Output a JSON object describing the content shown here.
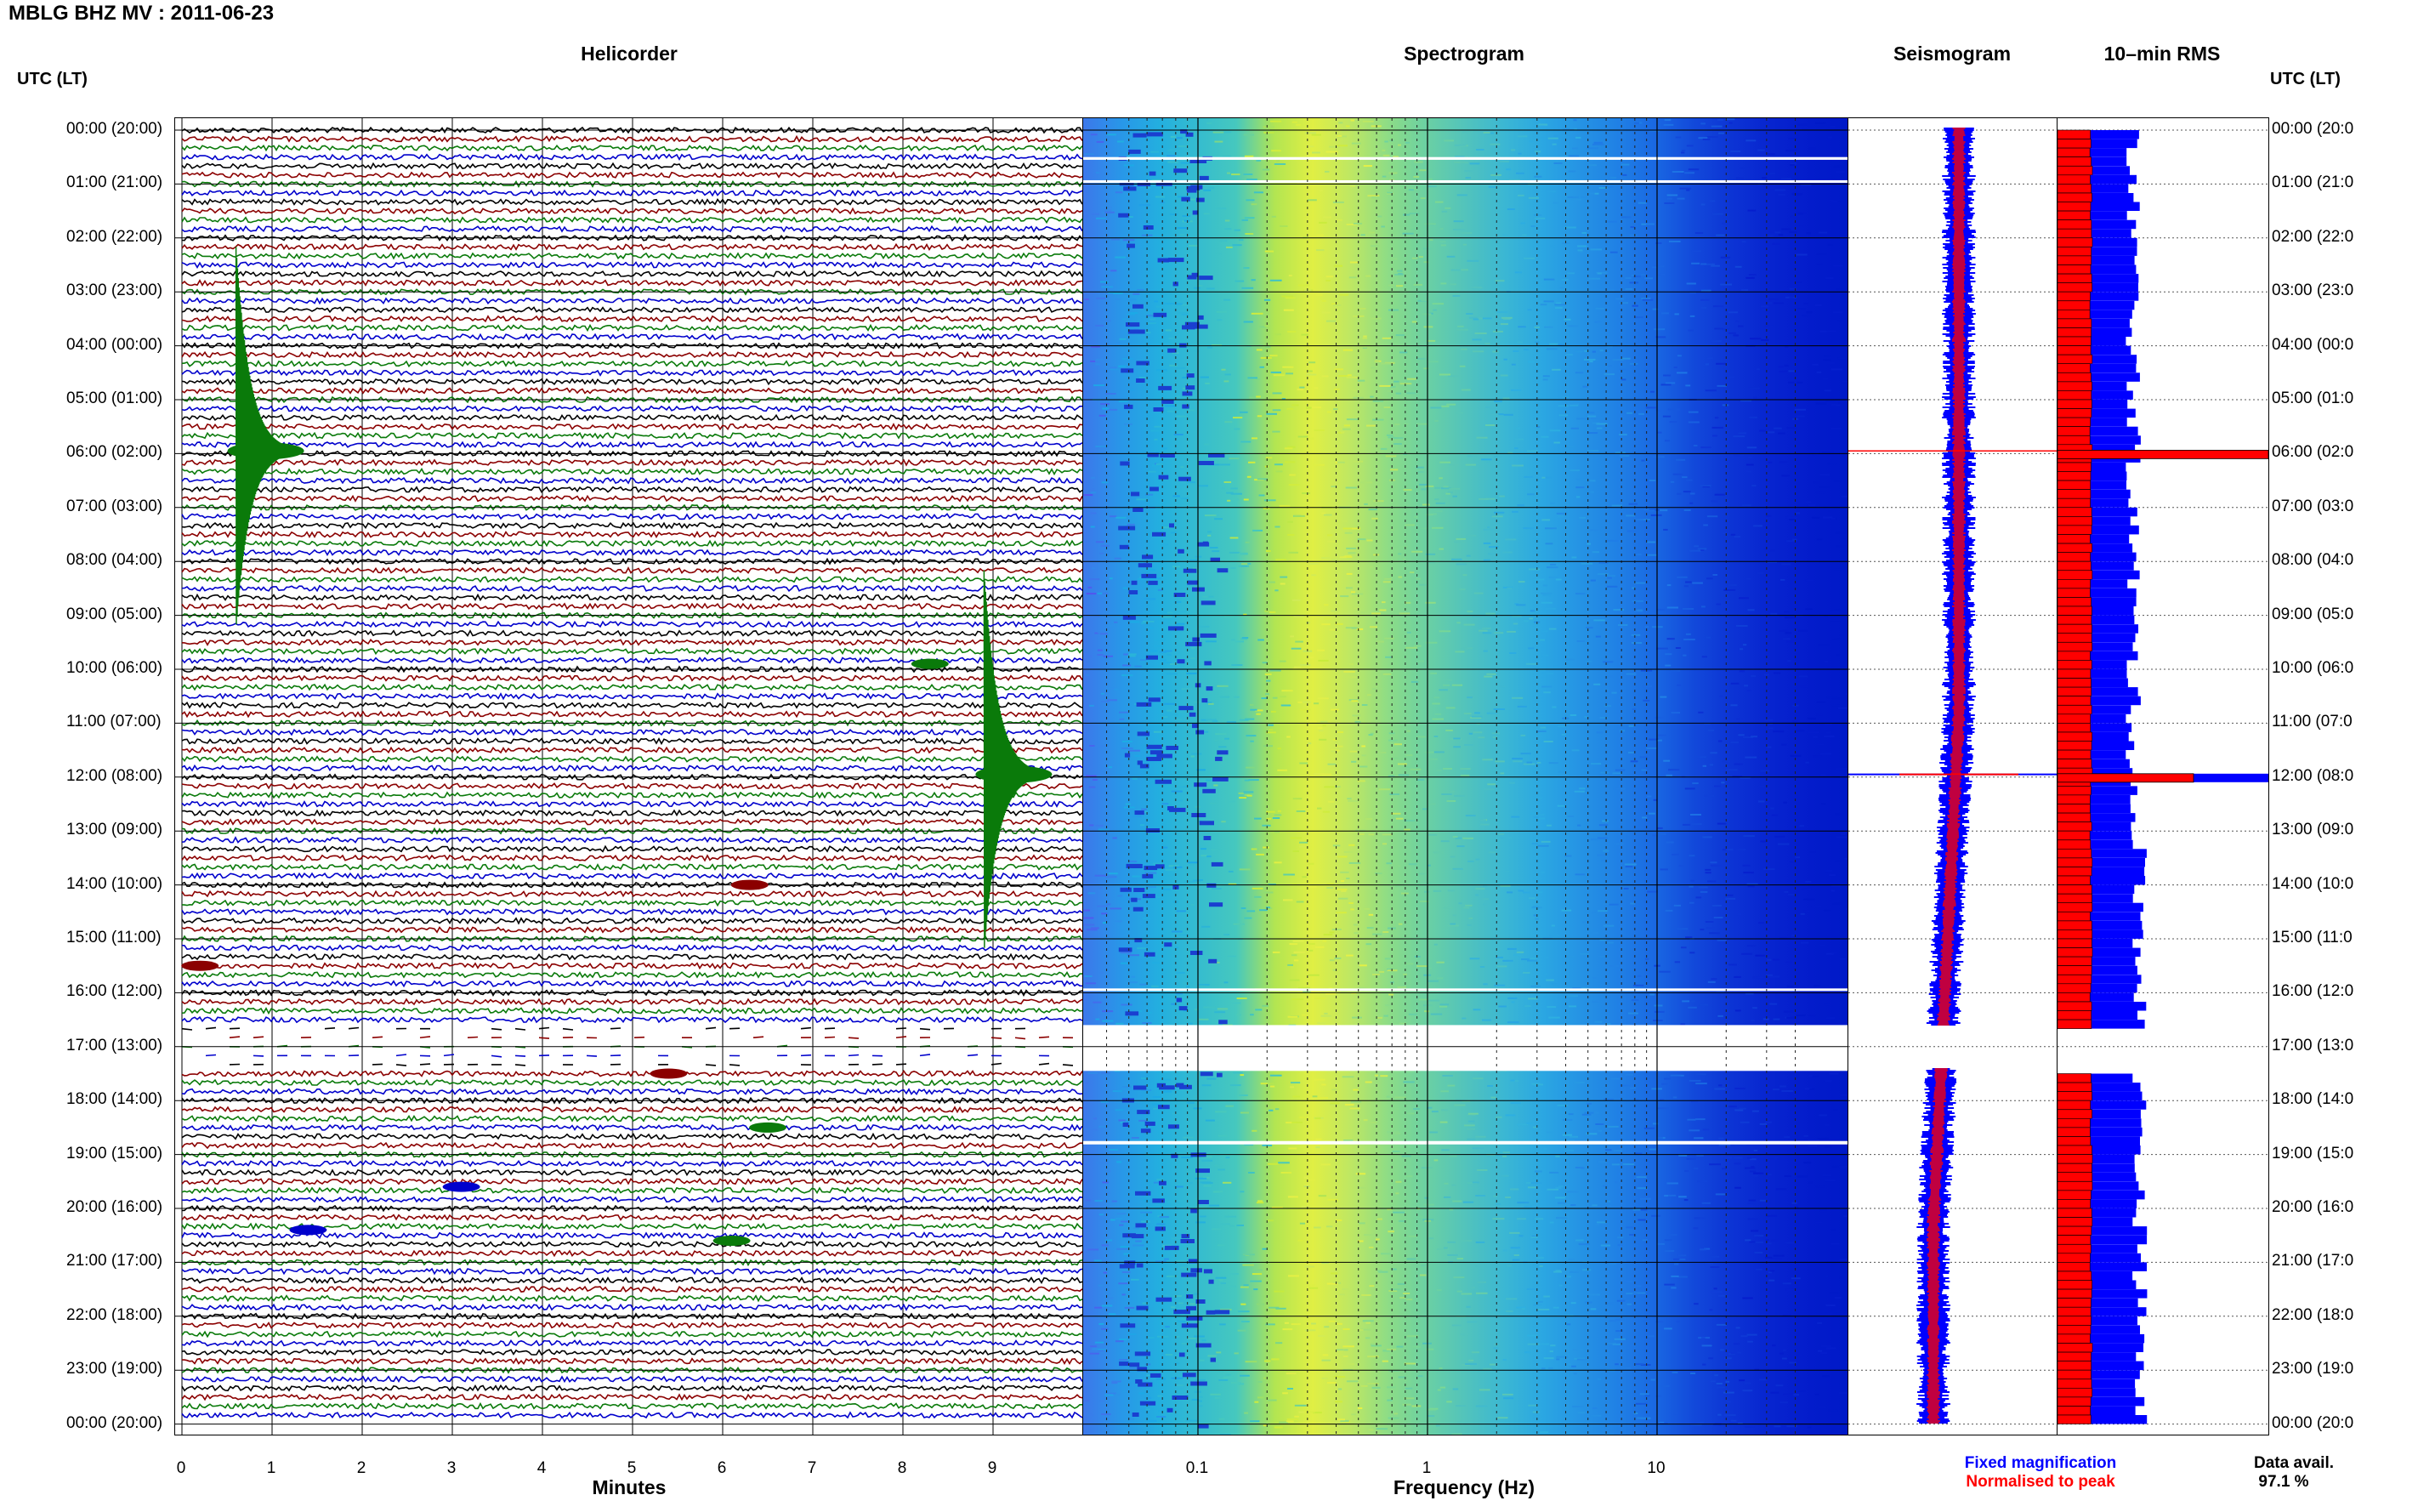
{
  "title": "MBLG BHZ MV : 2011-06-23",
  "panels": {
    "helicorder": "Helicorder",
    "spectrogram": "Spectrogram",
    "seismogram": "Seismogram",
    "rms": "10–min RMS"
  },
  "time_header": "UTC (LT)",
  "time_labels": [
    "00:00 (20:00)",
    "01:00 (21:00)",
    "02:00 (22:00)",
    "03:00 (23:00)",
    "04:00 (00:00)",
    "05:00 (01:00)",
    "06:00 (02:00)",
    "07:00 (03:00)",
    "08:00 (04:00)",
    "09:00 (05:00)",
    "10:00 (06:00)",
    "11:00 (07:00)",
    "12:00 (08:00)",
    "13:00 (09:00)",
    "14:00 (10:00)",
    "15:00 (11:00)",
    "16:00 (12:00)",
    "17:00 (13:00)",
    "18:00 (14:00)",
    "19:00 (15:00)",
    "20:00 (16:00)",
    "21:00 (17:00)",
    "22:00 (18:00)",
    "23:00 (19:00)",
    "00:00 (20:00)"
  ],
  "right_time_labels": [
    "00:00 (20:0",
    "01:00 (21:0",
    "02:00 (22:0",
    "03:00 (23:0",
    "04:00 (00:0",
    "05:00 (01:0",
    "06:00 (02:0",
    "07:00 (03:0",
    "08:00 (04:0",
    "09:00 (05:0",
    "10:00 (06:0",
    "11:00 (07:0",
    "12:00 (08:0",
    "13:00 (09:0",
    "14:00 (10:0",
    "15:00 (11:0",
    "16:00 (12:0",
    "17:00 (13:0",
    "18:00 (14:0",
    "19:00 (15:0",
    "20:00 (16:0",
    "21:00 (17:0",
    "22:00 (18:0",
    "23:00 (19:0",
    "00:00 (20:0"
  ],
  "helicorder_x_ticks": [
    "0",
    "1",
    "2",
    "3",
    "4",
    "5",
    "6",
    "7",
    "8",
    "9"
  ],
  "helicorder_xlabel": "Minutes",
  "spectrogram_x_ticks": [
    "0.1",
    "1",
    "10"
  ],
  "spectrogram_xlabel": "Frequency (Hz)",
  "legend": {
    "fixed": "Fixed magnification",
    "normalised": "Normalised to peak",
    "fixed_color": "#0000ff",
    "normalised_color": "#ff0000"
  },
  "data_avail_label": "Data avail.",
  "data_avail_value": "97.1 %",
  "chart_data": {
    "type": "heatmap",
    "title": "MBLG BHZ MV : 2011-06-23",
    "helicorder": {
      "minutes_per_line": 10,
      "hours": 24,
      "trace_colors": [
        "#000000",
        "#8b0000",
        "#0a7a0a",
        "#0000cc"
      ],
      "events": [
        {
          "hour": 5.95,
          "minute": 0.6,
          "amplitude": "large",
          "color": "#0a7a0a"
        },
        {
          "hour": 11.95,
          "minute": 8.9,
          "amplitude": "large",
          "color": "#0a7a0a"
        },
        {
          "hour": 9.9,
          "minute": 8.3,
          "amplitude": "small",
          "color": "#0a7a0a"
        },
        {
          "hour": 14.0,
          "minute": 6.3,
          "amplitude": "small",
          "color": "#8b0000"
        },
        {
          "hour": 15.5,
          "minute": 0.2,
          "amplitude": "small",
          "color": "#8b0000"
        },
        {
          "hour": 17.5,
          "minute": 5.4,
          "amplitude": "small",
          "color": "#8b0000"
        },
        {
          "hour": 18.5,
          "minute": 6.5,
          "amplitude": "small",
          "color": "#0a7a0a"
        },
        {
          "hour": 19.6,
          "minute": 3.1,
          "amplitude": "small",
          "color": "#0000cc"
        },
        {
          "hour": 20.4,
          "minute": 1.4,
          "amplitude": "small",
          "color": "#0000cc"
        },
        {
          "hour": 20.6,
          "minute": 6.1,
          "amplitude": "small",
          "color": "#0a7a0a"
        }
      ],
      "gaps_hours": [
        [
          16.6,
          17.4
        ]
      ]
    },
    "spectrogram": {
      "x_scale": "log",
      "xlim_hz": [
        0.03,
        50
      ],
      "gaps_hours": [
        [
          0.5,
          0.55
        ],
        [
          16.6,
          17.45
        ]
      ]
    },
    "rms_10min": {
      "peaks_hours": [
        6.0,
        12.0
      ],
      "normalised_color": "#ff0000",
      "fixed_color": "#0000ff"
    },
    "data_availability_percent": 97.1
  }
}
